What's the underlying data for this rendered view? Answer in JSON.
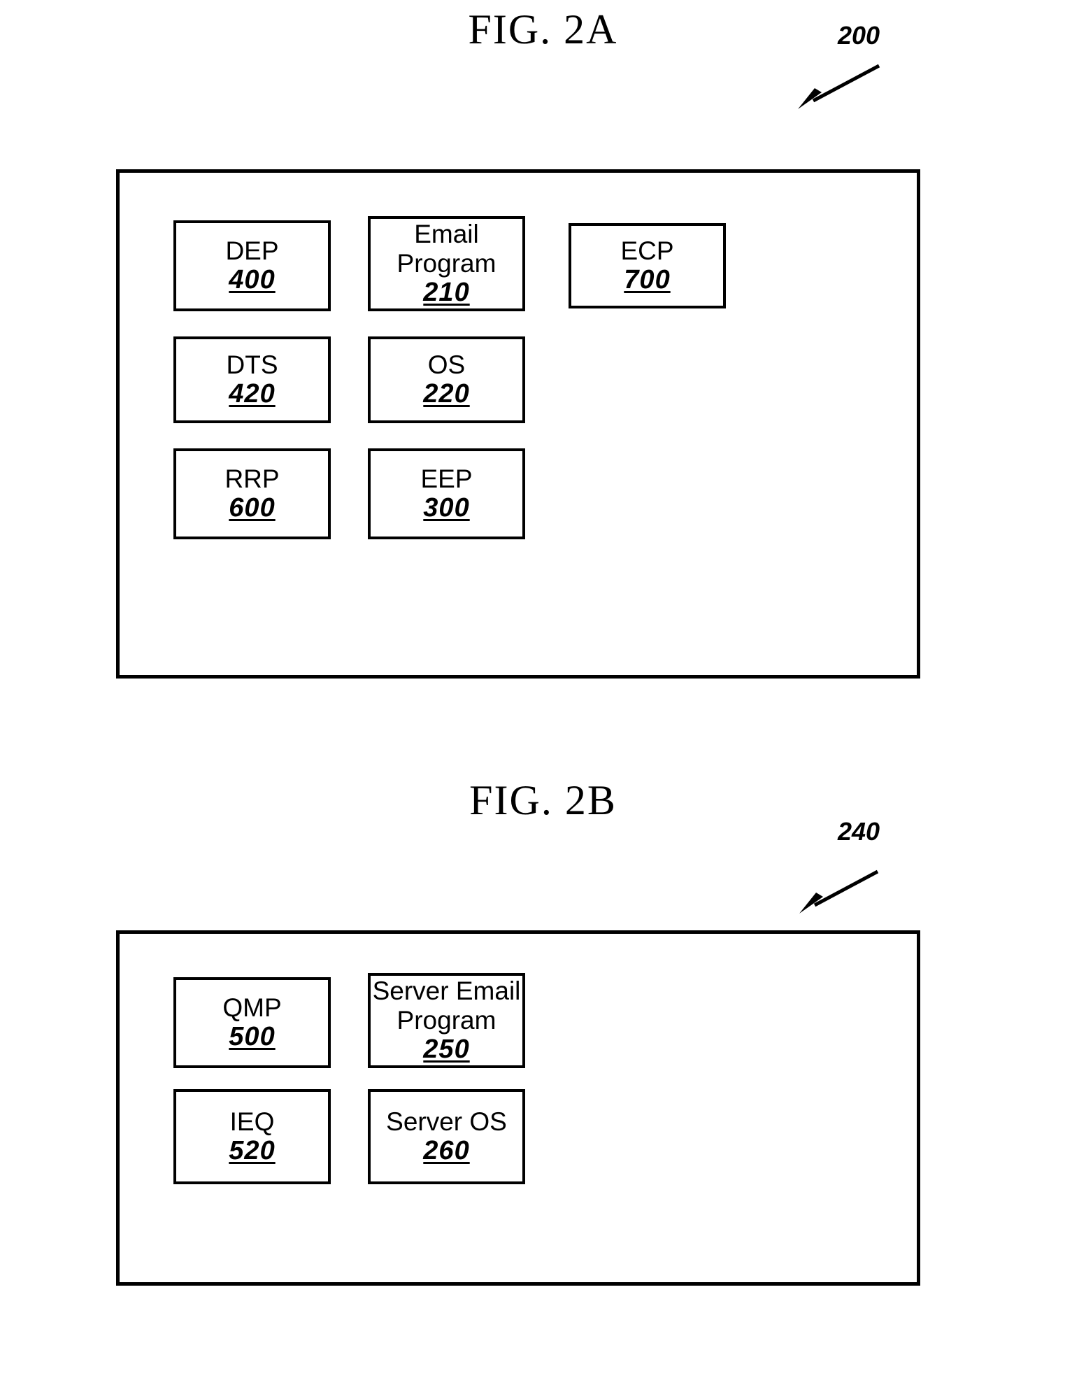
{
  "figures": [
    {
      "title": "FIG. 2A",
      "reference": "200",
      "boxes": [
        {
          "label": "DEP",
          "ref": "400"
        },
        {
          "label": "Email Program",
          "ref": "210"
        },
        {
          "label": "ECP",
          "ref": "700"
        },
        {
          "label": "DTS",
          "ref": "420"
        },
        {
          "label": "OS",
          "ref": "220"
        },
        {
          "label": "RRP",
          "ref": "600"
        },
        {
          "label": "EEP",
          "ref": "300"
        }
      ]
    },
    {
      "title": "FIG. 2B",
      "reference": "240",
      "boxes": [
        {
          "label": "QMP",
          "ref": "500"
        },
        {
          "label": "Server Email Program",
          "ref": "250"
        },
        {
          "label": "IEQ",
          "ref": "520"
        },
        {
          "label": "Server OS",
          "ref": "260"
        }
      ]
    }
  ],
  "icons": {
    "leader_arrow": "leader-arrow-icon"
  },
  "colors": {
    "ink": "#000000",
    "paper": "#ffffff"
  }
}
